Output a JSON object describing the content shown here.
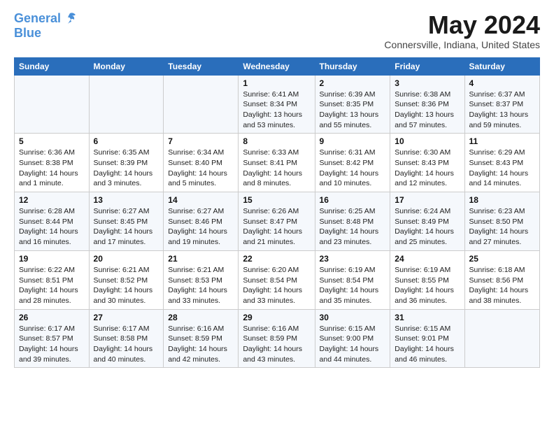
{
  "logo": {
    "line1": "General",
    "line2": "Blue"
  },
  "title": "May 2024",
  "subtitle": "Connersville, Indiana, United States",
  "days_header": [
    "Sunday",
    "Monday",
    "Tuesday",
    "Wednesday",
    "Thursday",
    "Friday",
    "Saturday"
  ],
  "weeks": [
    [
      {
        "day": "",
        "info": ""
      },
      {
        "day": "",
        "info": ""
      },
      {
        "day": "",
        "info": ""
      },
      {
        "day": "1",
        "info": "Sunrise: 6:41 AM\nSunset: 8:34 PM\nDaylight: 13 hours\nand 53 minutes."
      },
      {
        "day": "2",
        "info": "Sunrise: 6:39 AM\nSunset: 8:35 PM\nDaylight: 13 hours\nand 55 minutes."
      },
      {
        "day": "3",
        "info": "Sunrise: 6:38 AM\nSunset: 8:36 PM\nDaylight: 13 hours\nand 57 minutes."
      },
      {
        "day": "4",
        "info": "Sunrise: 6:37 AM\nSunset: 8:37 PM\nDaylight: 13 hours\nand 59 minutes."
      }
    ],
    [
      {
        "day": "5",
        "info": "Sunrise: 6:36 AM\nSunset: 8:38 PM\nDaylight: 14 hours\nand 1 minute."
      },
      {
        "day": "6",
        "info": "Sunrise: 6:35 AM\nSunset: 8:39 PM\nDaylight: 14 hours\nand 3 minutes."
      },
      {
        "day": "7",
        "info": "Sunrise: 6:34 AM\nSunset: 8:40 PM\nDaylight: 14 hours\nand 5 minutes."
      },
      {
        "day": "8",
        "info": "Sunrise: 6:33 AM\nSunset: 8:41 PM\nDaylight: 14 hours\nand 8 minutes."
      },
      {
        "day": "9",
        "info": "Sunrise: 6:31 AM\nSunset: 8:42 PM\nDaylight: 14 hours\nand 10 minutes."
      },
      {
        "day": "10",
        "info": "Sunrise: 6:30 AM\nSunset: 8:43 PM\nDaylight: 14 hours\nand 12 minutes."
      },
      {
        "day": "11",
        "info": "Sunrise: 6:29 AM\nSunset: 8:43 PM\nDaylight: 14 hours\nand 14 minutes."
      }
    ],
    [
      {
        "day": "12",
        "info": "Sunrise: 6:28 AM\nSunset: 8:44 PM\nDaylight: 14 hours\nand 16 minutes."
      },
      {
        "day": "13",
        "info": "Sunrise: 6:27 AM\nSunset: 8:45 PM\nDaylight: 14 hours\nand 17 minutes."
      },
      {
        "day": "14",
        "info": "Sunrise: 6:27 AM\nSunset: 8:46 PM\nDaylight: 14 hours\nand 19 minutes."
      },
      {
        "day": "15",
        "info": "Sunrise: 6:26 AM\nSunset: 8:47 PM\nDaylight: 14 hours\nand 21 minutes."
      },
      {
        "day": "16",
        "info": "Sunrise: 6:25 AM\nSunset: 8:48 PM\nDaylight: 14 hours\nand 23 minutes."
      },
      {
        "day": "17",
        "info": "Sunrise: 6:24 AM\nSunset: 8:49 PM\nDaylight: 14 hours\nand 25 minutes."
      },
      {
        "day": "18",
        "info": "Sunrise: 6:23 AM\nSunset: 8:50 PM\nDaylight: 14 hours\nand 27 minutes."
      }
    ],
    [
      {
        "day": "19",
        "info": "Sunrise: 6:22 AM\nSunset: 8:51 PM\nDaylight: 14 hours\nand 28 minutes."
      },
      {
        "day": "20",
        "info": "Sunrise: 6:21 AM\nSunset: 8:52 PM\nDaylight: 14 hours\nand 30 minutes."
      },
      {
        "day": "21",
        "info": "Sunrise: 6:21 AM\nSunset: 8:53 PM\nDaylight: 14 hours\nand 33 minutes."
      },
      {
        "day": "22",
        "info": "Sunrise: 6:20 AM\nSunset: 8:54 PM\nDaylight: 14 hours\nand 33 minutes."
      },
      {
        "day": "23",
        "info": "Sunrise: 6:19 AM\nSunset: 8:54 PM\nDaylight: 14 hours\nand 35 minutes."
      },
      {
        "day": "24",
        "info": "Sunrise: 6:19 AM\nSunset: 8:55 PM\nDaylight: 14 hours\nand 36 minutes."
      },
      {
        "day": "25",
        "info": "Sunrise: 6:18 AM\nSunset: 8:56 PM\nDaylight: 14 hours\nand 38 minutes."
      }
    ],
    [
      {
        "day": "26",
        "info": "Sunrise: 6:17 AM\nSunset: 8:57 PM\nDaylight: 14 hours\nand 39 minutes."
      },
      {
        "day": "27",
        "info": "Sunrise: 6:17 AM\nSunset: 8:58 PM\nDaylight: 14 hours\nand 40 minutes."
      },
      {
        "day": "28",
        "info": "Sunrise: 6:16 AM\nSunset: 8:59 PM\nDaylight: 14 hours\nand 42 minutes."
      },
      {
        "day": "29",
        "info": "Sunrise: 6:16 AM\nSunset: 8:59 PM\nDaylight: 14 hours\nand 43 minutes."
      },
      {
        "day": "30",
        "info": "Sunrise: 6:15 AM\nSunset: 9:00 PM\nDaylight: 14 hours\nand 44 minutes."
      },
      {
        "day": "31",
        "info": "Sunrise: 6:15 AM\nSunset: 9:01 PM\nDaylight: 14 hours\nand 46 minutes."
      },
      {
        "day": "",
        "info": ""
      }
    ]
  ]
}
